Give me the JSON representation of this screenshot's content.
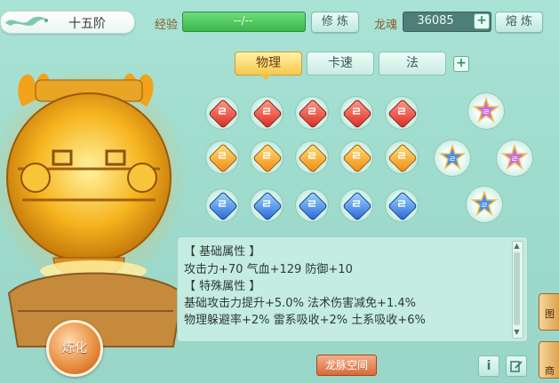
{
  "header": {
    "level_badge": "十五阶",
    "exp_label": "经验",
    "exp_value": "--/--",
    "practice_button": "修 炼",
    "soul_label": "龙魂",
    "soul_value": "36085",
    "smelt_button": "熔 炼"
  },
  "tabs": [
    {
      "label": "物理",
      "active": true
    },
    {
      "label": "卡速",
      "active": false
    },
    {
      "label": "法",
      "active": false
    }
  ],
  "gems": {
    "rows": [
      [
        "red",
        "red",
        "red",
        "red",
        "red"
      ],
      [
        "orange",
        "orange",
        "orange",
        "orange",
        "orange"
      ],
      [
        "blue",
        "blue",
        "blue",
        "blue",
        "blue"
      ]
    ],
    "mark": "ㄹ"
  },
  "info": {
    "section1_title": "【 基础属性 】",
    "base_stats": "攻击力+70  气血+129  防御+10",
    "section2_title": "【 特殊属性 】",
    "special_line1": "基础攻击力提升+5.0%  法术伤害减免+1.4%",
    "special_line2": "物理躲避率+2%  雷系吸收+2%  土系吸收+6%"
  },
  "buttons": {
    "refine": "炼化",
    "dragon_space": "龙脉空间",
    "info_icon": "i"
  },
  "side_tabs": [
    "图",
    "商"
  ],
  "colors": {
    "background": "#a9e3d6",
    "exp_bar": "#3ab84c",
    "active_tab": "#f7c84d",
    "refine_button": "#e78a3d"
  }
}
